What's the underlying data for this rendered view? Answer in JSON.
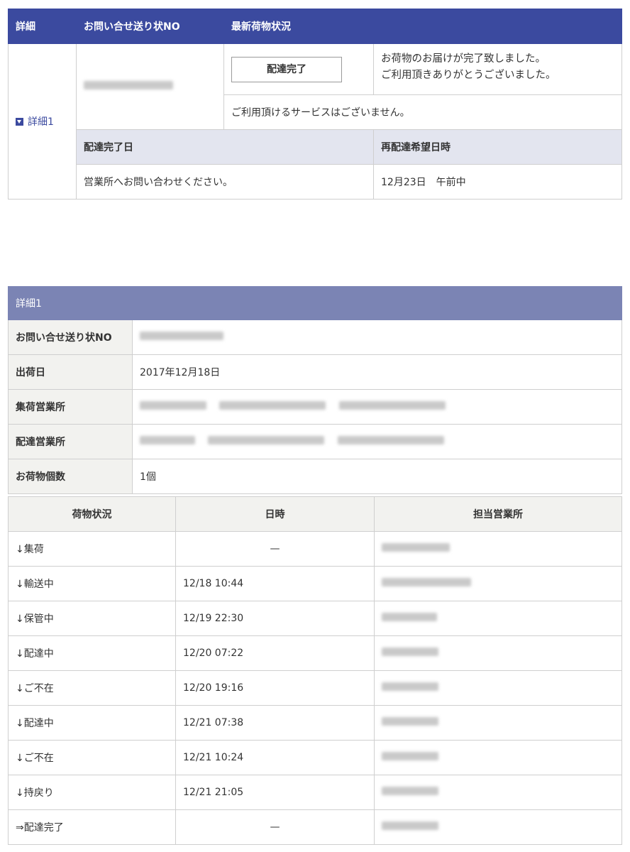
{
  "summary": {
    "headers": {
      "detail": "詳細",
      "inquiry_no": "お問い合せ送り状NO",
      "latest_status": "最新荷物状況"
    },
    "detail_link": "詳細1",
    "status_button": "配達完了",
    "status_message_line1": "お荷物のお届けが完了致しました。",
    "status_message_line2": "ご利用頂きありがとうございました。",
    "service_message": "ご利用頂けるサービスはございません。",
    "sub_headers": {
      "delivery_date": "配達完了日",
      "redelivery": "再配達希望日時"
    },
    "delivery_date_value": "営業所へお問い合わせください。",
    "redelivery_value": "12月23日　午前中"
  },
  "detail": {
    "title": "詳細1",
    "rows": [
      {
        "label": "お問い合せ送り状NO",
        "value": ""
      },
      {
        "label": "出荷日",
        "value": "2017年12月18日"
      },
      {
        "label": "集荷営業所",
        "value": ""
      },
      {
        "label": "配達営業所",
        "value": ""
      },
      {
        "label": "お荷物個数",
        "value": "1個"
      }
    ]
  },
  "history": {
    "headers": {
      "status": "荷物状況",
      "datetime": "日時",
      "office": "担当営業所"
    },
    "rows": [
      {
        "status": "↓集荷",
        "datetime": "—"
      },
      {
        "status": "↓輸送中",
        "datetime": "12/18 10:44"
      },
      {
        "status": "↓保管中",
        "datetime": "12/19 22:30"
      },
      {
        "status": "↓配達中",
        "datetime": "12/20 07:22"
      },
      {
        "status": "↓ご不在",
        "datetime": "12/20 19:16"
      },
      {
        "status": "↓配達中",
        "datetime": "12/21 07:38"
      },
      {
        "status": "↓ご不在",
        "datetime": "12/21 10:24"
      },
      {
        "status": "↓持戻り",
        "datetime": "12/21 21:05"
      },
      {
        "status": "⇒配達完了",
        "datetime": "—"
      }
    ]
  }
}
